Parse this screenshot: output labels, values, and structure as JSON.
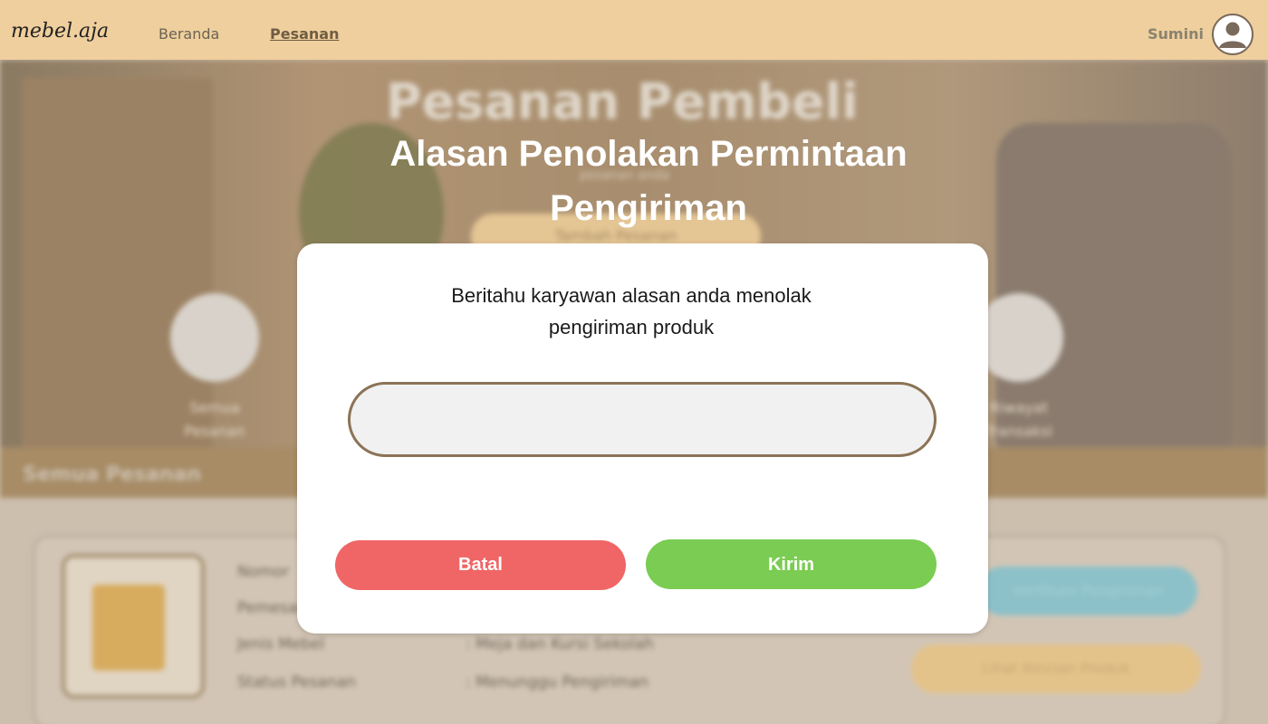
{
  "navbar": {
    "logo": "mebel.aja",
    "links": [
      "Beranda",
      "Pesanan"
    ],
    "active_link": "Pesanan",
    "user_name": "Sumini",
    "avatar_icon": "user-avatar-icon"
  },
  "background_page": {
    "hero_title": "Pesanan Pembeli",
    "hero_subtitle": "pesanan anda",
    "hero_button": "Tambah Pesanan",
    "categories": [
      {
        "label_line1": "Semua",
        "label_line2": "Pesanan",
        "icon": "mail-icon"
      },
      {
        "label_line1": "Riwayat",
        "label_line2": "Transaksi",
        "icon": "clipboard-icon"
      }
    ],
    "section_title": "Semua Pesanan",
    "order": {
      "labels": [
        "Nomor",
        "Pemesan",
        "Jenis Mebel",
        "Status Pesanan"
      ],
      "values": [
        "",
        "",
        ": Meja dan Kursi Sekolah",
        ": Menunggu Pengiriman"
      ],
      "verify_button": "Verifikasi Pengiriman",
      "detail_button": "Lihat Rincian Produk"
    }
  },
  "modal": {
    "title": "Alasan Penolakan Permintaan Pengiriman",
    "description": "Beritahu karyawan alasan anda menolak pengiriman produk",
    "input_value": "",
    "input_placeholder": "",
    "cancel_label": "Batal",
    "submit_label": "Kirim"
  },
  "colors": {
    "navbar_bg": "#efcf9d",
    "cancel_button": "#f06666",
    "submit_button": "#7acc52",
    "input_border": "#8b7356",
    "input_bg": "#f1f1f1"
  }
}
